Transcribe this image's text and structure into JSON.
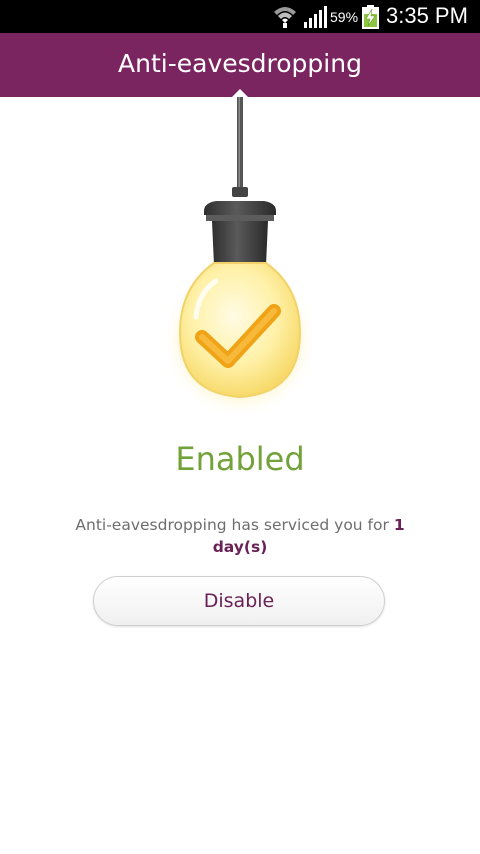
{
  "status_bar": {
    "battery_percent": "59%",
    "time": "3:35 PM",
    "icons": [
      "wifi-icon",
      "signal-icon",
      "battery-charging-icon"
    ]
  },
  "header": {
    "title": "Anti-eavesdropping"
  },
  "main": {
    "illustration": "light-bulb-checkmark-icon",
    "status": "Enabled",
    "service_prefix": "Anti-eavesdropping has serviced you for ",
    "service_duration": "1 day(s)"
  },
  "actions": {
    "disable_label": "Disable"
  },
  "colors": {
    "header_bg": "#7a2560",
    "status_green": "#72a239",
    "accent_purple": "#6a2155",
    "check_orange": "#f5a419"
  }
}
